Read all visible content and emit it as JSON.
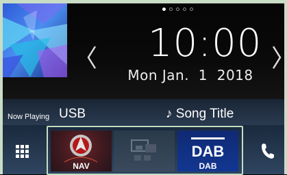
{
  "clock": {
    "time": "10:00",
    "date": "Mon Jan.  1  2018"
  },
  "page_indicator": {
    "total": 5,
    "active": 1
  },
  "now_playing": {
    "label": "Now Playing",
    "source": "USB",
    "song_title": "♪ Song Title"
  },
  "shortcuts": [
    {
      "label": "NAV",
      "icon": "navigation-icon"
    },
    {
      "label": "",
      "icon": "screen-mirror-icon"
    },
    {
      "label": "DAB",
      "icon": "dab-logo-icon"
    }
  ],
  "icons": {
    "apps": "grid-icon",
    "phone": "phone-icon",
    "prev": "chevron-left-icon",
    "next": "chevron-right-icon"
  },
  "colors": {
    "focus_frame": "#c4dfc3",
    "dab_tile": "#123791",
    "nav_tile": "#6c2327"
  }
}
